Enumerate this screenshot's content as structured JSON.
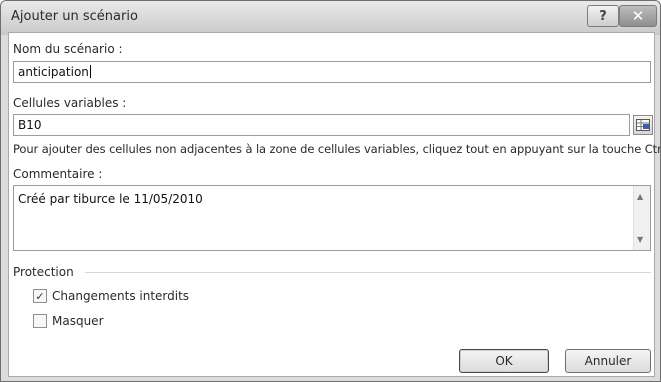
{
  "dialog": {
    "title": "Ajouter un scénario",
    "help_glyph": "?",
    "close_glyph": "✕"
  },
  "scenario_name": {
    "label": "Nom du scénario :",
    "value": "anticipation"
  },
  "changing_cells": {
    "label": "Cellules variables :",
    "value": "B10",
    "hint": "Pour ajouter des cellules non adjacentes à la zone de cellules variables, cliquez tout en appuyant sur la touche Ctrl."
  },
  "comment": {
    "label": "Commentaire :",
    "value": "Créé par tiburce le 11/05/2010"
  },
  "protection": {
    "label": "Protection",
    "prevent_changes": {
      "label": "Changements interdits",
      "checked": true
    },
    "hide": {
      "label": "Masquer",
      "checked": false
    }
  },
  "buttons": {
    "ok": "OK",
    "cancel": "Annuler"
  },
  "icons": {
    "help": "help-icon",
    "close": "close-icon",
    "range_picker": "range-picker-icon"
  }
}
